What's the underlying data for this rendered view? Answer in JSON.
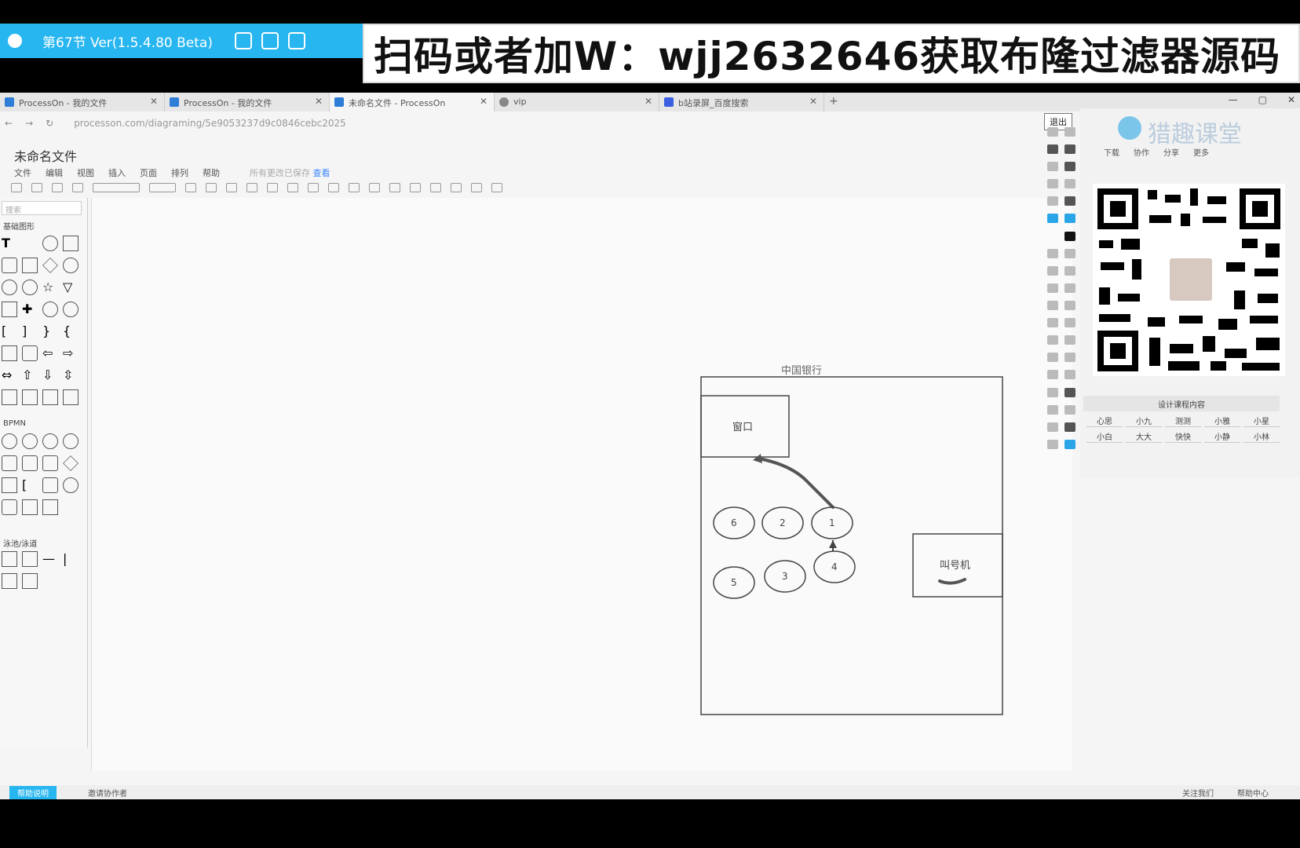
{
  "player": {
    "lesson": "第67节 Ver(1.5.4.80 Beta)"
  },
  "promo": {
    "text": "扫码或者加W：wjj2632646获取布隆过滤器源码"
  },
  "browser": {
    "tabs": [
      {
        "label": "ProcessOn - 我的文件"
      },
      {
        "label": "ProcessOn - 我的文件"
      },
      {
        "label": "未命名文件 - ProcessOn"
      },
      {
        "label": "vip"
      },
      {
        "label": "b站录屏_百度搜索"
      }
    ],
    "url": "processon.com/diagraming/5e9053237d9c0846cebc2025",
    "exit_label": "退出"
  },
  "editor": {
    "doc_title": "未命名文件",
    "menu": [
      "文件",
      "编辑",
      "视图",
      "插入",
      "页面",
      "排列",
      "帮助"
    ],
    "save_hint": "所有更改已保存",
    "save_link": "查看",
    "search_placeholder": "搜索",
    "categories": [
      "基础图形",
      "BPMN",
      "泳池/泳道"
    ],
    "status": {
      "help": "帮助说明",
      "invite": "邀请协作者",
      "follow": "关注我们",
      "help_center": "帮助中心"
    }
  },
  "diagram": {
    "container_label": "中国银行",
    "window_label": "窗口",
    "ticket_label": "叫号机",
    "circles": [
      "1",
      "2",
      "3",
      "4",
      "5",
      "6"
    ]
  },
  "side_panel": {
    "brand": "猎趣课堂",
    "tabs": [
      "下载",
      "协作",
      "分享",
      "更多"
    ],
    "subtitle": "设计课程内容",
    "grid": [
      "心思",
      "小九",
      "测测",
      "小雅",
      "小星",
      "小白",
      "大大",
      "快快",
      "小静",
      "小林"
    ]
  },
  "colors": {
    "player_bar": "#27b6f0",
    "accent": "#2aa5e8"
  }
}
